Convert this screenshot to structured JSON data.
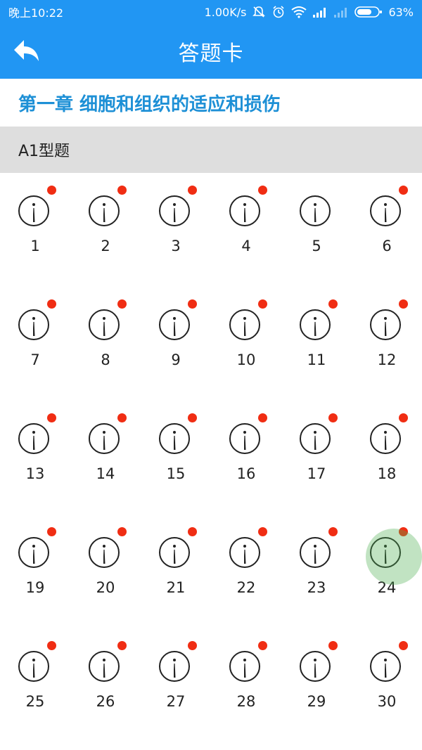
{
  "status_bar": {
    "time": "晚上10:22",
    "net_speed": "1.00K/s",
    "battery": "63%",
    "icons": [
      "silent-alarm-icon",
      "alarm-clock-icon",
      "wifi-icon",
      "signal-icon",
      "signal-weak-icon",
      "battery-icon"
    ]
  },
  "header": {
    "title": "答题卡",
    "back_icon": "back-arrow-icon"
  },
  "chapter": {
    "title": "第一章 细胞和组织的适应和损伤"
  },
  "section": {
    "title": "A1型题"
  },
  "questions": [
    {
      "number": "1",
      "has_badge": true
    },
    {
      "number": "2",
      "has_badge": true
    },
    {
      "number": "3",
      "has_badge": true
    },
    {
      "number": "4",
      "has_badge": true
    },
    {
      "number": "5",
      "has_badge": false
    },
    {
      "number": "6",
      "has_badge": true
    },
    {
      "number": "7",
      "has_badge": true
    },
    {
      "number": "8",
      "has_badge": true
    },
    {
      "number": "9",
      "has_badge": true
    },
    {
      "number": "10",
      "has_badge": true
    },
    {
      "number": "11",
      "has_badge": true
    },
    {
      "number": "12",
      "has_badge": true
    },
    {
      "number": "13",
      "has_badge": true
    },
    {
      "number": "14",
      "has_badge": true
    },
    {
      "number": "15",
      "has_badge": true
    },
    {
      "number": "16",
      "has_badge": true
    },
    {
      "number": "17",
      "has_badge": true
    },
    {
      "number": "18",
      "has_badge": true
    },
    {
      "number": "19",
      "has_badge": true
    },
    {
      "number": "20",
      "has_badge": true
    },
    {
      "number": "21",
      "has_badge": true
    },
    {
      "number": "22",
      "has_badge": true
    },
    {
      "number": "23",
      "has_badge": true
    },
    {
      "number": "24",
      "has_badge": true,
      "pressed": true
    },
    {
      "number": "25",
      "has_badge": true
    },
    {
      "number": "26",
      "has_badge": true
    },
    {
      "number": "27",
      "has_badge": true
    },
    {
      "number": "28",
      "has_badge": true
    },
    {
      "number": "29",
      "has_badge": true
    },
    {
      "number": "30",
      "has_badge": true
    }
  ],
  "colors": {
    "primary": "#2196F3",
    "chapter_text": "#1E90D6",
    "section_bg": "#DEDEDE",
    "badge": "#F02D13",
    "ripple": "#4CAF50"
  }
}
